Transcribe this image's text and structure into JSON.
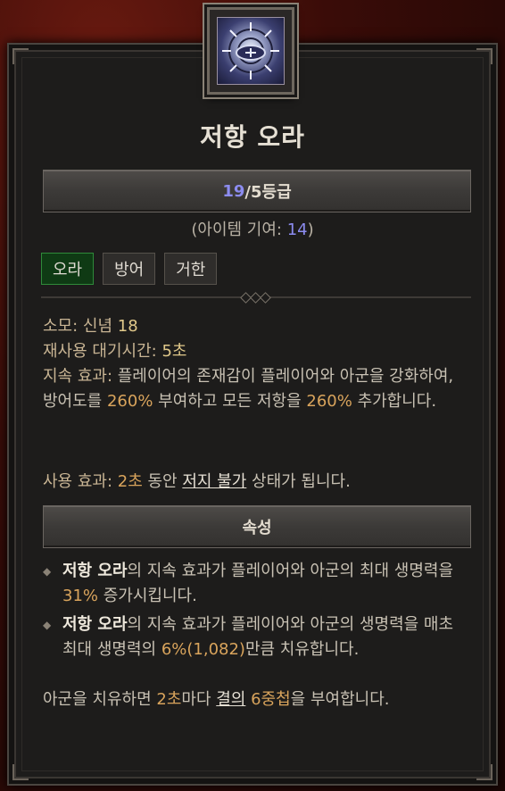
{
  "skill": {
    "name": "저항 오라",
    "icon": "shield-aura-icon",
    "rank": {
      "current": "19",
      "suffix": "/5등급"
    },
    "contribution": {
      "prefix": "(아이템 기여: ",
      "value": "14",
      "suffix": ")"
    },
    "tags": [
      "오라",
      "방어",
      "거한"
    ]
  },
  "stats": {
    "cost_label": "소모: 신념 ",
    "cost_value": "18",
    "cooldown_label": "재사용 대기시간: ",
    "cooldown_value": "5초",
    "passive_label": "지속 효과: ",
    "passive_text_1": "플레이어의 존재감이 플레이어와 아군을 강화하여, 방어도를 ",
    "passive_val_1": "260%",
    "passive_text_2": " 부여하고 모든 저항을 ",
    "passive_val_2": "260%",
    "passive_text_3": " 추가합니다.",
    "active_label": "사용 효과: ",
    "active_val": "2초",
    "active_text_1": " 동안 ",
    "active_link": "저지 불가",
    "active_text_2": " 상태가 됩니다."
  },
  "properties": {
    "header": "속성",
    "items": [
      {
        "bold": "저항 오라",
        "text_1": "의 지속 효과가 플레이어와 아군의 최대 생명력을 ",
        "value": "31%",
        "text_2": " 증가시킵니다."
      },
      {
        "bold": "저항 오라",
        "text_1": "의 지속 효과가 플레이어와 아군의 생명력을 매초 최대 생명력의 ",
        "value": "6%(1,082)",
        "text_2": "만큼 치유합니다."
      }
    ],
    "footer_text_1": "아군을 치유하면 ",
    "footer_val_1": "2초",
    "footer_text_2": "마다 ",
    "footer_link": "결의",
    "footer_text_3": " ",
    "footer_val_2": "6중첩",
    "footer_text_4": "을 부여합니다."
  },
  "colors": {
    "rank_blue": "#8c8cf0",
    "value_gold": "#e0c88a",
    "value_orange": "#d9a45c",
    "active_tag": "#0f3a14"
  }
}
